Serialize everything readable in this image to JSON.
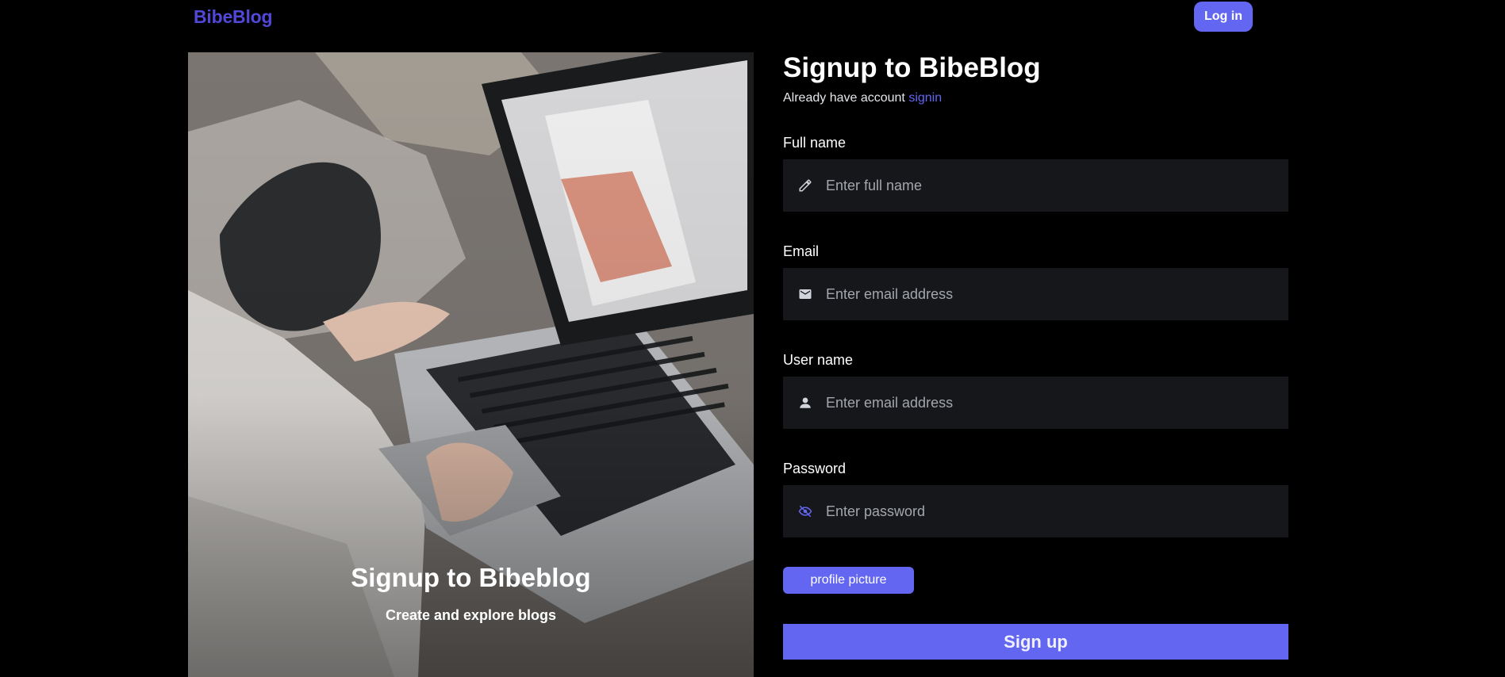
{
  "navbar": {
    "brand": "BibeBlog",
    "login_label": "Log in"
  },
  "hero": {
    "image_alt": "person typing on laptop",
    "title": "Signup to Bibeblog",
    "subtitle": "Create and explore blogs"
  },
  "form": {
    "title": "Signup to BibeBlog",
    "already_text": "Already have account",
    "signin_link": "signin",
    "fields": [
      {
        "label": "Full name",
        "placeholder": "Enter full name",
        "icon": "pencil-icon"
      },
      {
        "label": "Email",
        "placeholder": "Enter email address",
        "icon": "mail-icon"
      },
      {
        "label": "User name",
        "placeholder": "Enter email address",
        "icon": "user-icon"
      },
      {
        "label": "Password",
        "placeholder": "Enter password",
        "icon": "eye-off-icon"
      }
    ],
    "profile_picture_label": "profile picture",
    "submit_label": "Sign up"
  },
  "colors": {
    "background": "#000000",
    "accent": "#6366f1",
    "brand": "#5148d8",
    "input_bg": "#16171b"
  }
}
